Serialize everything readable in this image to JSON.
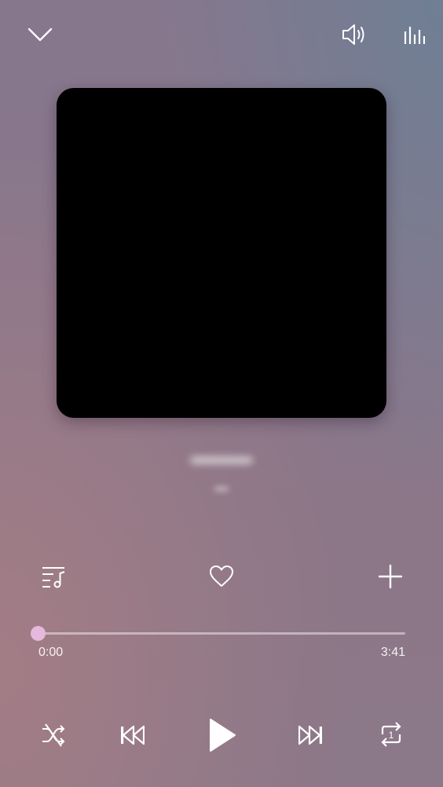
{
  "header": {
    "collapse_icon": "chevron-down-icon",
    "volume_icon": "volume-icon",
    "equalizer_icon": "equalizer-icon"
  },
  "album": {
    "artwork_color": "#000000"
  },
  "actions": {
    "playlist_icon": "playlist-music-icon",
    "favorite_icon": "heart-icon",
    "add_icon": "plus-icon"
  },
  "progress": {
    "current_time": "0:00",
    "total_time": "3:41",
    "fraction": 0.0,
    "accent": "#e6b8dc"
  },
  "controls": {
    "shuffle_icon": "shuffle-off-icon",
    "previous_icon": "skip-previous-icon",
    "play_icon": "play-icon",
    "next_icon": "skip-next-icon",
    "repeat_icon": "repeat-one-icon",
    "repeat_badge": "1"
  }
}
